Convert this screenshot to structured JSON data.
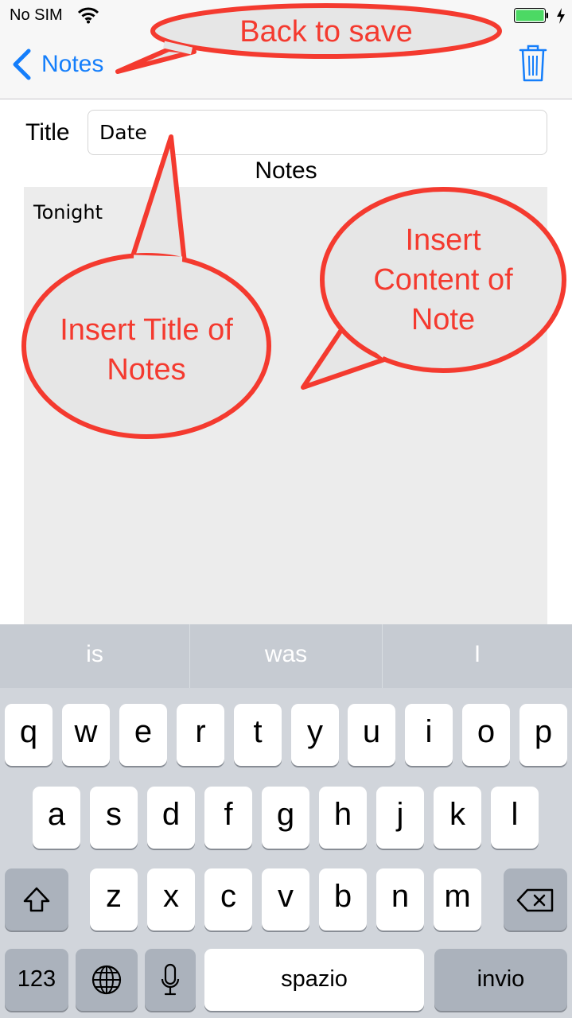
{
  "status_bar": {
    "carrier": "No SIM",
    "battery_color": "#4cd964",
    "wifi_icon": "wifi-icon",
    "charging_icon": "charging-bolt-icon"
  },
  "nav": {
    "back_label": "Notes",
    "back_icon": "chevron-left-icon",
    "trash_icon": "trash-icon",
    "accent": "#147efb"
  },
  "form": {
    "title_label": "Title",
    "title_value": "Date",
    "notes_heading": "Notes",
    "notes_value": "Tonight"
  },
  "callouts": {
    "back": "Back to save",
    "title_line1": "Insert Title of",
    "title_line2": "Notes",
    "content_line1": "Insert",
    "content_line2": "Content of",
    "content_line3": "Note",
    "color": "#f43a2f"
  },
  "keyboard": {
    "suggestions": [
      "is",
      "was",
      "I"
    ],
    "row1": [
      "q",
      "w",
      "e",
      "r",
      "t",
      "y",
      "u",
      "i",
      "o",
      "p"
    ],
    "row2": [
      "a",
      "s",
      "d",
      "f",
      "g",
      "h",
      "j",
      "k",
      "l"
    ],
    "row3": [
      "z",
      "x",
      "c",
      "v",
      "b",
      "n",
      "m"
    ],
    "numbers_label": "123",
    "space_label": "spazio",
    "return_label": "invio",
    "shift_icon": "shift-icon",
    "delete_icon": "backspace-icon",
    "globe_icon": "globe-icon",
    "mic_icon": "microphone-icon"
  }
}
